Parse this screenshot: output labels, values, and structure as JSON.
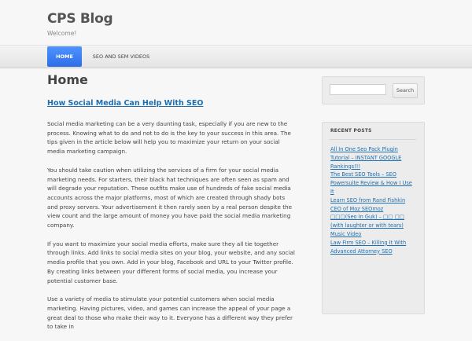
{
  "site": {
    "title": "CPS Blog",
    "description": "Welcome!"
  },
  "nav": {
    "items": [
      {
        "label": "HOME"
      },
      {
        "label": "SEO AND SEM VIDEOS"
      }
    ]
  },
  "main": {
    "page_title": "Home",
    "post_title": "How Social Media Can Help With SEO",
    "paragraphs": [
      "Social media marketing can be a very daunting task, especially if you are new to the process. Knowing what to do and not to do is the key to your success in this area. The tips given in the article below will help you to maximize your return on your social media marketing campaign.",
      "You should take caution when utilizing the services of a firm for your social media marketing needs. For starters, their black hat techniques are often seen as spam and will degrade your reputation. These outfits make use of hundreds of fake social media accounts across the major platforms, most of which are created through shady bots and proxy servers. Your advertisement it then rarely seen by a real person despite the view count and the large amount of money you have paid the social media marketing company.",
      "If you want to maximize your social media efforts, make sure they all tie together through links. Add links to social media sites on your blog, your website, and any social media profile that you own. Add in your blog, Facebook and URL to your Twitter profile. By creating links between your different forms of social media, you increase your potential customer base.",
      "Use a variety of media to stimulate your potential customers when social media marketing. Having pictures, video, and games can increase the appeal of your page a great deal to those who make their way to it. Everyone has a different way they prefer to take in"
    ]
  },
  "sidebar": {
    "search": {
      "placeholder": "",
      "button_label": "Search"
    },
    "recent_posts": {
      "title": "RECENT POSTS",
      "items": [
        "All In One Seo Pack Plugin Tutorial – INSTANT GOOGLE Rankings!!!",
        "The Best SEO Tools – SEO Powersuite Review & How I Use It",
        "Learn SEO from Rand Fishkin CEO of Moz SEOmoz",
        "□□□(Seo In Guk) – □□ □□ (with laughter or with tears) Music Video",
        "Law Firm SEO – Killing It With Advanced Attorney SEO"
      ]
    }
  }
}
